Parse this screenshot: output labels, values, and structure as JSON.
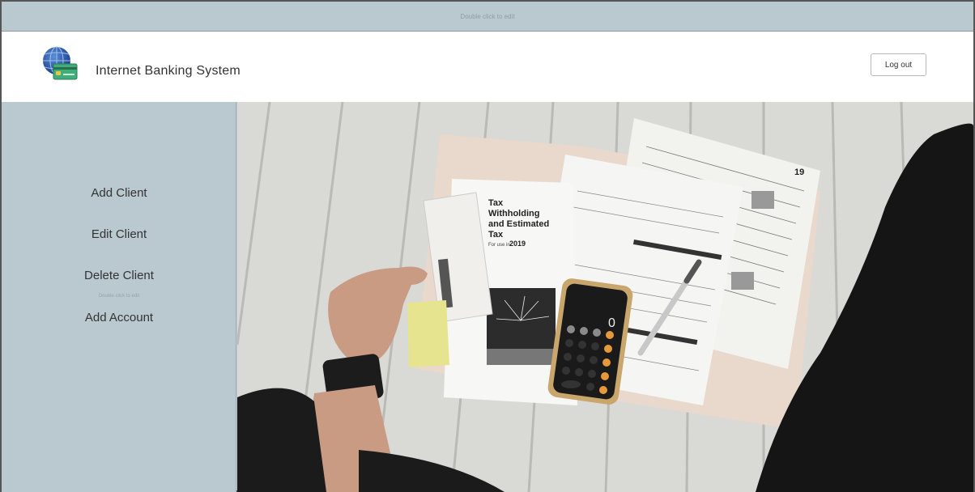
{
  "top_strip": {
    "hint": "Double click to edit"
  },
  "header": {
    "title": "Internet Banking System",
    "logout_label": "Log out",
    "logo_icon": "globe-card-icon"
  },
  "sidebar": {
    "items": [
      {
        "label": "Add Client"
      },
      {
        "label": "Edit Client"
      },
      {
        "label": "Delete Client"
      },
      {
        "label": "Add Account"
      }
    ],
    "hint": "Double click to edit"
  },
  "hero": {
    "document_heading": [
      "Tax",
      "Withholding",
      "and Estimated",
      "Tax"
    ],
    "document_year_text": "For use in",
    "document_year": "2019",
    "form_year": "19",
    "calculator_display": "0"
  },
  "colors": {
    "panel": "#bac8d0",
    "header_bg": "#ffffff",
    "text": "#333333"
  }
}
